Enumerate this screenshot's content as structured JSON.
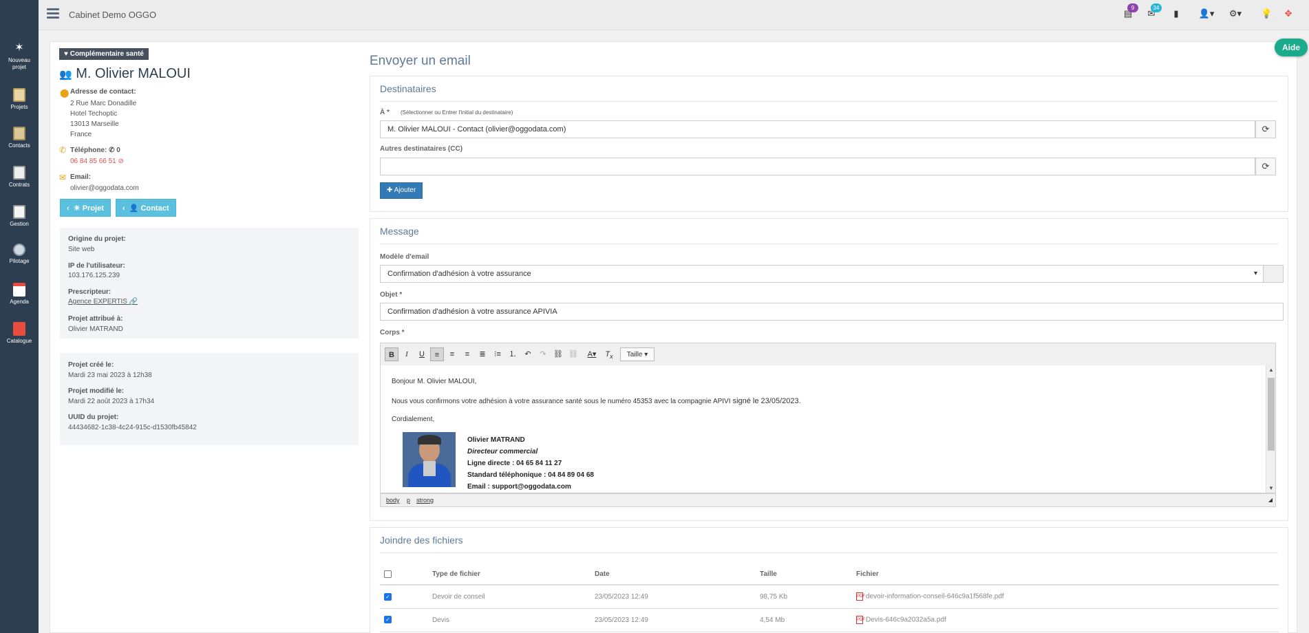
{
  "app_title": "Cabinet Demo OGGO",
  "header": {
    "badge_tasks": "9",
    "badge_mail": "34"
  },
  "sidebar": {
    "items": [
      {
        "label": "Nouveau projet",
        "icon": "magic-wand-icon"
      },
      {
        "label": "Projets",
        "icon": "projects-icon"
      },
      {
        "label": "Contacts",
        "icon": "contacts-icon"
      },
      {
        "label": "Contrats",
        "icon": "contracts-icon"
      },
      {
        "label": "Gestion",
        "icon": "management-icon"
      },
      {
        "label": "Pilotage",
        "icon": "compass-icon"
      },
      {
        "label": "Agenda",
        "icon": "calendar-icon"
      },
      {
        "label": "Catalogue",
        "icon": "catalog-icon"
      }
    ]
  },
  "aide_label": "Aide",
  "contact": {
    "tag": "Complémentaire santé",
    "name": "M. Olivier MALOUI",
    "address_label": "Adresse de contact:",
    "address_lines": [
      "2 Rue Marc Donadille",
      "Hotel Techoptic",
      "13013 Marseille",
      "France"
    ],
    "phone_label": "Téléphone:",
    "phone_count": "0",
    "phone": "06 84 85 66 51",
    "email_label": "Email:",
    "email": "olivier@oggodata.com",
    "btn_projet": "Projet",
    "btn_contact": "Contact"
  },
  "project_info": {
    "origine_label": "Origine du projet:",
    "origine": "Site web",
    "ip_label": "IP de l'utilisateur:",
    "ip": "103.176.125.239",
    "prescripteur_label": "Prescripteur:",
    "prescripteur": "Agence EXPERTIS",
    "attribue_label": "Projet attribué à:",
    "attribue": "Olivier MATRAND"
  },
  "project_dates": {
    "cree_label": "Projet créé le:",
    "cree": "Mardi 23 mai 2023 à 12h38",
    "modifie_label": "Projet modifié le:",
    "modifie": "Mardi 22 août 2023 à 17h34",
    "uuid_label": "UUID du projet:",
    "uuid": "44434682-1c38-4c24-915c-d1530fb45842"
  },
  "page_title": "Envoyer un email",
  "destinataires": {
    "title": "Destinataires",
    "to_label": "À *",
    "to_hint": "(Sélectionner ou Entrer l'initial du destinataire)",
    "to_value": "M. Olivier MALOUI - Contact (olivier@oggodata.com)",
    "cc_label": "Autres destinataires (CC)",
    "cc_value": "",
    "add_label": "Ajouter"
  },
  "message": {
    "title": "Message",
    "model_label": "Modèle d'email",
    "model_value": "Confirmation d'adhésion à votre assurance",
    "subject_label": "Objet *",
    "subject_value": "Confirmation d'adhésion à votre assurance APIVIA",
    "body_label": "Corps *",
    "size_label": "Taille",
    "body": {
      "greeting": "Bonjour M. Olivier MALOUI,",
      "line1_prefix": "Nous vous confirmons votre adhésion à votre assurance santé sous le numéro 45353 avec la compagnie APIVI",
      "line1_suffix": " signé le   23/05/2023.",
      "closing": "Cordialement,",
      "sig_name": "Olivier MATRAND",
      "sig_title": "Directeur commercial",
      "sig_direct": "Ligne directe : 04 65 84 11 27",
      "sig_standard": "Standard téléphonique : 04 84 89 04 68",
      "sig_email": "Email : support@oggodata.com"
    },
    "status_path": [
      "body",
      "p",
      "strong"
    ]
  },
  "attachments": {
    "title": "Joindre des fichiers",
    "headers": [
      "Type de fichier",
      "Date",
      "Taille",
      "Fichier"
    ],
    "rows": [
      {
        "type": "Devoir de conseil",
        "date": "23/05/2023 12:49",
        "size": "98,75 Kb",
        "file": "devoir-information-conseil-646c9a1f568fe.pdf"
      },
      {
        "type": "Devis",
        "date": "23/05/2023 12:49",
        "size": "4,54 Mb",
        "file": "Devis-646c9a2032a5a.pdf"
      }
    ]
  }
}
